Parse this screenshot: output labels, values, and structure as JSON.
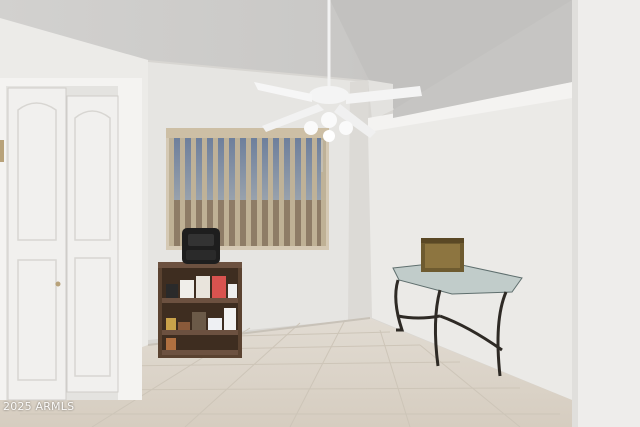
{
  "watermark": "2025 ARMLS",
  "colors": {
    "ceiling": "#d9d8d6",
    "wall": "#e9e8e5",
    "wall_shadow": "#dcdad6",
    "floor_tile": "#ddd6cc",
    "grout": "#c9c1b5",
    "door": "#f1f0ee",
    "blind": "#c8b89a",
    "shelf": "#5a4230",
    "table_metal": "#2e2a25"
  },
  "scene": {
    "room": "interior-room",
    "objects": [
      "bifold-closet-door",
      "window-with-vertical-blinds",
      "ceiling-fan-with-lights",
      "small-bookshelf",
      "air-fryer",
      "glass-console-table",
      "decorative-box"
    ]
  }
}
